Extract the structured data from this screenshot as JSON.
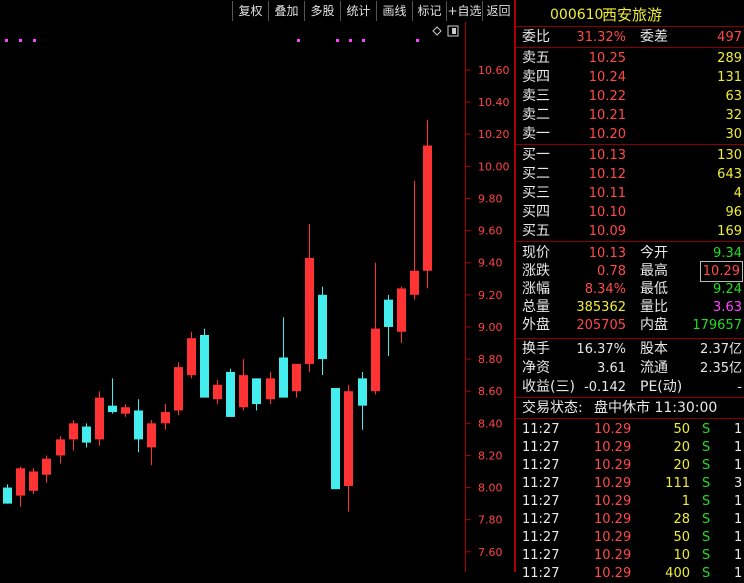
{
  "toolbar": {
    "buttons": [
      "复权",
      "叠加",
      "多股",
      "统计",
      "画线",
      "标记",
      "+自选",
      "返回"
    ]
  },
  "stock": {
    "code": "000610",
    "name": "西安旅游"
  },
  "weibi": {
    "label1": "委比",
    "value1": "31.32%",
    "label2": "委差",
    "value2": "497"
  },
  "sells": [
    {
      "label": "卖五",
      "price": "10.25",
      "vol": "289"
    },
    {
      "label": "卖四",
      "price": "10.24",
      "vol": "131"
    },
    {
      "label": "卖三",
      "price": "10.22",
      "vol": "63"
    },
    {
      "label": "卖二",
      "price": "10.21",
      "vol": "32"
    },
    {
      "label": "卖一",
      "price": "10.20",
      "vol": "30"
    }
  ],
  "buys": [
    {
      "label": "买一",
      "price": "10.13",
      "vol": "130"
    },
    {
      "label": "买二",
      "price": "10.12",
      "vol": "643"
    },
    {
      "label": "买三",
      "price": "10.11",
      "vol": "4"
    },
    {
      "label": "买四",
      "price": "10.10",
      "vol": "96"
    },
    {
      "label": "买五",
      "price": "10.09",
      "vol": "169"
    }
  ],
  "quote": [
    {
      "l1": "现价",
      "v1": "10.13",
      "c1": "red",
      "l2": "今开",
      "v2": "9.34",
      "c2": "green"
    },
    {
      "l1": "涨跌",
      "v1": "0.78",
      "c1": "red",
      "l2": "最高",
      "v2": "10.29",
      "c2": "red"
    },
    {
      "l1": "涨幅",
      "v1": "8.34%",
      "c1": "red",
      "l2": "最低",
      "v2": "9.24",
      "c2": "green"
    },
    {
      "l1": "总量",
      "v1": "385362",
      "c1": "yellow",
      "l2": "量比",
      "v2": "3.63",
      "c2": "magenta"
    },
    {
      "l1": "外盘",
      "v1": "205705",
      "c1": "red",
      "l2": "内盘",
      "v2": "179657",
      "c2": "green"
    }
  ],
  "fundamentals": [
    {
      "l1": "换手",
      "v1": "16.37%",
      "l2": "股本",
      "v2": "2.37亿"
    },
    {
      "l1": "净资",
      "v1": "3.61",
      "l2": "流通",
      "v2": "2.35亿"
    },
    {
      "l1": "收益(三)",
      "v1": "-0.142",
      "l2": "PE(动)",
      "v2": "-"
    }
  ],
  "trade_status": {
    "label": "交易状态:",
    "value": "盘中休市 11:30:00"
  },
  "ticks": [
    {
      "time": "11:27",
      "price": "10.29",
      "vol": "50",
      "side": "S",
      "n": "1"
    },
    {
      "time": "11:27",
      "price": "10.29",
      "vol": "20",
      "side": "S",
      "n": "1"
    },
    {
      "time": "11:27",
      "price": "10.29",
      "vol": "20",
      "side": "S",
      "n": "1"
    },
    {
      "time": "11:27",
      "price": "10.29",
      "vol": "111",
      "side": "S",
      "n": "3"
    },
    {
      "time": "11:27",
      "price": "10.29",
      "vol": "1",
      "side": "S",
      "n": "1"
    },
    {
      "time": "11:27",
      "price": "10.29",
      "vol": "28",
      "side": "S",
      "n": "1"
    },
    {
      "time": "11:27",
      "price": "10.29",
      "vol": "50",
      "side": "S",
      "n": "1"
    },
    {
      "time": "11:27",
      "price": "10.29",
      "vol": "10",
      "side": "S",
      "n": "1"
    },
    {
      "time": "11:27",
      "price": "10.29",
      "vol": "400",
      "side": "S",
      "n": "1"
    }
  ],
  "chart_data": {
    "type": "candlestick",
    "y_ticks": [
      "10.60",
      "10.40",
      "10.20",
      "10.00",
      "9.80",
      "9.60",
      "9.40",
      "9.20",
      "9.00",
      "8.80",
      "8.60",
      "8.40",
      "8.20",
      "8.00",
      "7.80",
      "7.60"
    ],
    "ylim": [
      7.52,
      10.86
    ],
    "up_color": "#ff3333",
    "down_color": "#44eeee",
    "candles": [
      {
        "o": 8.0,
        "h": 8.02,
        "l": 7.9,
        "c": 7.9
      },
      {
        "o": 7.95,
        "h": 8.13,
        "l": 7.88,
        "c": 8.12
      },
      {
        "o": 7.98,
        "h": 8.12,
        "l": 7.96,
        "c": 8.1
      },
      {
        "o": 8.08,
        "h": 8.2,
        "l": 8.03,
        "c": 8.18
      },
      {
        "o": 8.2,
        "h": 8.32,
        "l": 8.15,
        "c": 8.3
      },
      {
        "o": 8.3,
        "h": 8.42,
        "l": 8.23,
        "c": 8.4
      },
      {
        "o": 8.38,
        "h": 8.4,
        "l": 8.25,
        "c": 8.28
      },
      {
        "o": 8.3,
        "h": 8.6,
        "l": 8.26,
        "c": 8.56
      },
      {
        "o": 8.51,
        "h": 8.68,
        "l": 8.46,
        "c": 8.47
      },
      {
        "o": 8.46,
        "h": 8.52,
        "l": 8.44,
        "c": 8.5
      },
      {
        "o": 8.48,
        "h": 8.55,
        "l": 8.22,
        "c": 8.3
      },
      {
        "o": 8.25,
        "h": 8.42,
        "l": 8.14,
        "c": 8.4
      },
      {
        "o": 8.4,
        "h": 8.52,
        "l": 8.36,
        "c": 8.47
      },
      {
        "o": 8.48,
        "h": 8.78,
        "l": 8.45,
        "c": 8.75
      },
      {
        "o": 8.7,
        "h": 8.97,
        "l": 8.68,
        "c": 8.93
      },
      {
        "o": 8.95,
        "h": 8.99,
        "l": 8.56,
        "c": 8.56
      },
      {
        "o": 8.55,
        "h": 8.67,
        "l": 8.52,
        "c": 8.64
      },
      {
        "o": 8.72,
        "h": 8.74,
        "l": 8.44,
        "c": 8.44
      },
      {
        "o": 8.5,
        "h": 8.8,
        "l": 8.48,
        "c": 8.7
      },
      {
        "o": 8.68,
        "h": 8.68,
        "l": 8.48,
        "c": 8.52
      },
      {
        "o": 8.55,
        "h": 8.72,
        "l": 8.52,
        "c": 8.68
      },
      {
        "o": 8.81,
        "h": 9.06,
        "l": 8.58,
        "c": 8.56
      },
      {
        "o": 8.6,
        "h": 8.77,
        "l": 8.56,
        "c": 8.77
      },
      {
        "o": 8.77,
        "h": 9.64,
        "l": 8.72,
        "c": 9.43
      },
      {
        "o": 9.2,
        "h": 9.25,
        "l": 8.7,
        "c": 8.8
      },
      {
        "o": 8.62,
        "h": 8.62,
        "l": 7.99,
        "c": 7.99
      },
      {
        "o": 8.01,
        "h": 8.64,
        "l": 7.85,
        "c": 8.6
      },
      {
        "o": 8.68,
        "h": 8.72,
        "l": 8.36,
        "c": 8.51
      },
      {
        "o": 8.6,
        "h": 9.4,
        "l": 8.58,
        "c": 8.99
      },
      {
        "o": 9.17,
        "h": 9.2,
        "l": 8.82,
        "c": 9.0
      },
      {
        "o": 8.97,
        "h": 9.25,
        "l": 8.9,
        "c": 9.24
      },
      {
        "o": 9.2,
        "h": 9.91,
        "l": 9.17,
        "c": 9.35
      },
      {
        "o": 9.35,
        "h": 10.29,
        "l": 9.24,
        "c": 10.13
      }
    ]
  }
}
